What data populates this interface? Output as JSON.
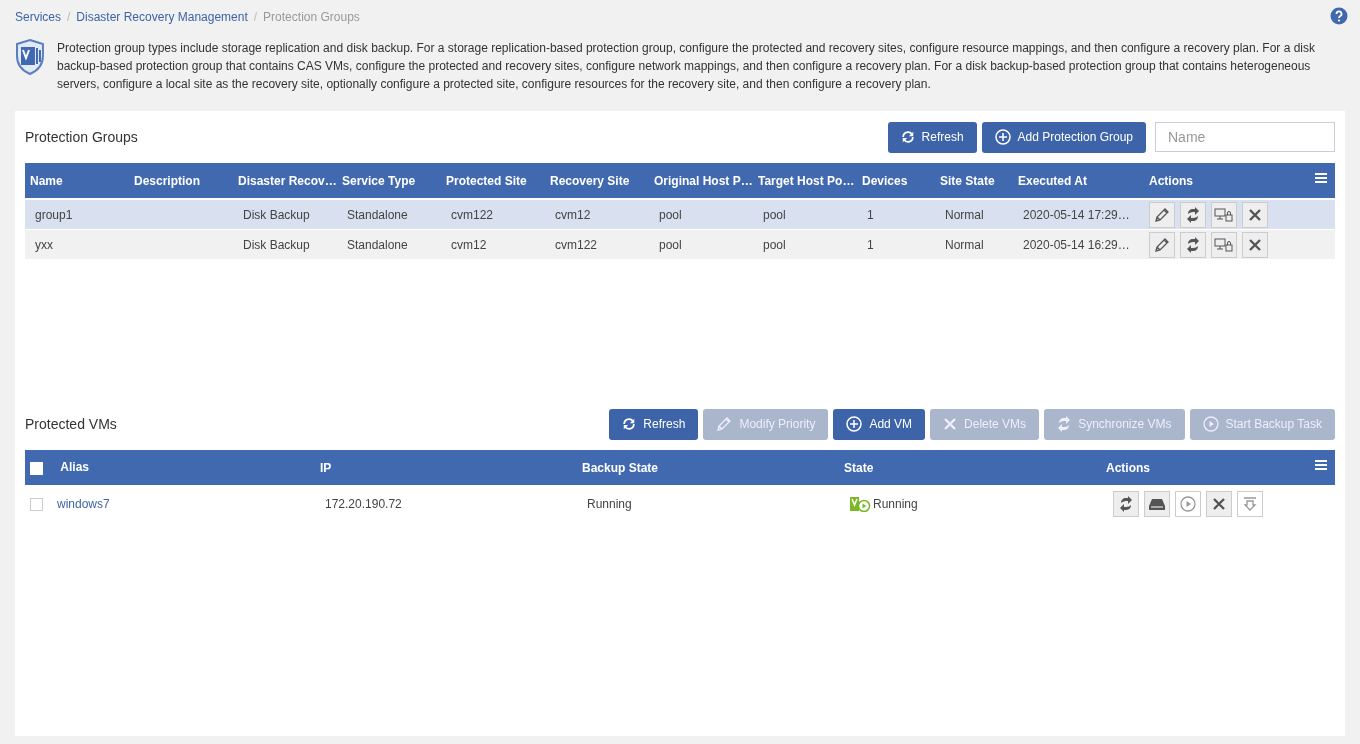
{
  "breadcrumb": [
    {
      "label": "Services",
      "current": false,
      "separator": "/"
    },
    {
      "label": "Disaster Recovery Management",
      "current": false,
      "separator": "/"
    },
    {
      "label": "Protection Groups",
      "current": true
    }
  ],
  "info": "Protection group types include storage replication and disk backup. For a storage replication-based protection group, configure the protected and recovery sites, configure resource mappings, and then configure a recovery plan. For a disk backup-based protection group that contains CAS VMs, configure the protected and recovery sites, configure network mappings, and then configure a recovery plan. For a disk backup-based protection group that contains heterogeneous servers, configure a local site as the recovery site, optionally configure a protected site, configure resources for the recovery site, and then configure a recovery plan.",
  "groups": {
    "title": "Protection Groups",
    "buttons": [
      {
        "label": "Refresh",
        "kind": "refresh",
        "disabled": false
      },
      {
        "label": "Add Protection Group",
        "kind": "add",
        "disabled": false
      }
    ],
    "search": {
      "placeholder": "Name"
    },
    "columns": [
      "Name",
      "Description",
      "Disaster Recov…",
      "Service Type",
      "Protected Site",
      "Recovery Site",
      "Original Host P…",
      "Target Host Po…",
      "Devices",
      "Site State",
      "Executed At",
      "Actions"
    ],
    "rows": [
      {
        "selected": true,
        "cells": [
          "group1",
          "",
          "Disk Backup",
          "Standalone",
          "cvm122",
          "cvm12",
          "pool",
          "pool",
          "1",
          "Normal",
          "2020-05-14 17:29…"
        ],
        "actions": [
          {
            "kind": "edit",
            "disabled": false
          },
          {
            "kind": "sync",
            "disabled": false
          },
          {
            "kind": "vm-lock",
            "disabled": false
          },
          {
            "kind": "delete",
            "disabled": false
          }
        ]
      },
      {
        "selected": false,
        "cells": [
          "yxx",
          "",
          "Disk Backup",
          "Standalone",
          "cvm12",
          "cvm122",
          "pool",
          "pool",
          "1",
          "Normal",
          "2020-05-14 16:29…"
        ],
        "actions": [
          {
            "kind": "edit",
            "disabled": false
          },
          {
            "kind": "sync",
            "disabled": false
          },
          {
            "kind": "vm-lock",
            "disabled": false
          },
          {
            "kind": "delete",
            "disabled": false
          }
        ]
      }
    ]
  },
  "vms": {
    "title": "Protected VMs",
    "buttons": [
      {
        "label": "Refresh",
        "kind": "refresh",
        "disabled": false
      },
      {
        "label": "Modify Priority",
        "kind": "edit",
        "disabled": true
      },
      {
        "label": "Add VM",
        "kind": "add",
        "disabled": false
      },
      {
        "label": "Delete VMs",
        "kind": "delete",
        "disabled": true
      },
      {
        "label": "Synchronize VMs",
        "kind": "sync",
        "disabled": true
      },
      {
        "label": "Start Backup Task",
        "kind": "play",
        "disabled": true
      }
    ],
    "select_all_checked": false,
    "columns": [
      "Alias",
      "IP",
      "Backup State",
      "State",
      "Actions"
    ],
    "rows": [
      {
        "checked": false,
        "alias": "windows7",
        "ip": "172.20.190.72",
        "backup_state": "Running",
        "state": "Running",
        "actions": [
          {
            "kind": "sync",
            "disabled": false
          },
          {
            "kind": "disk",
            "disabled": false
          },
          {
            "kind": "play",
            "disabled": true
          },
          {
            "kind": "delete",
            "disabled": false
          },
          {
            "kind": "download",
            "disabled": true
          }
        ]
      }
    ]
  }
}
